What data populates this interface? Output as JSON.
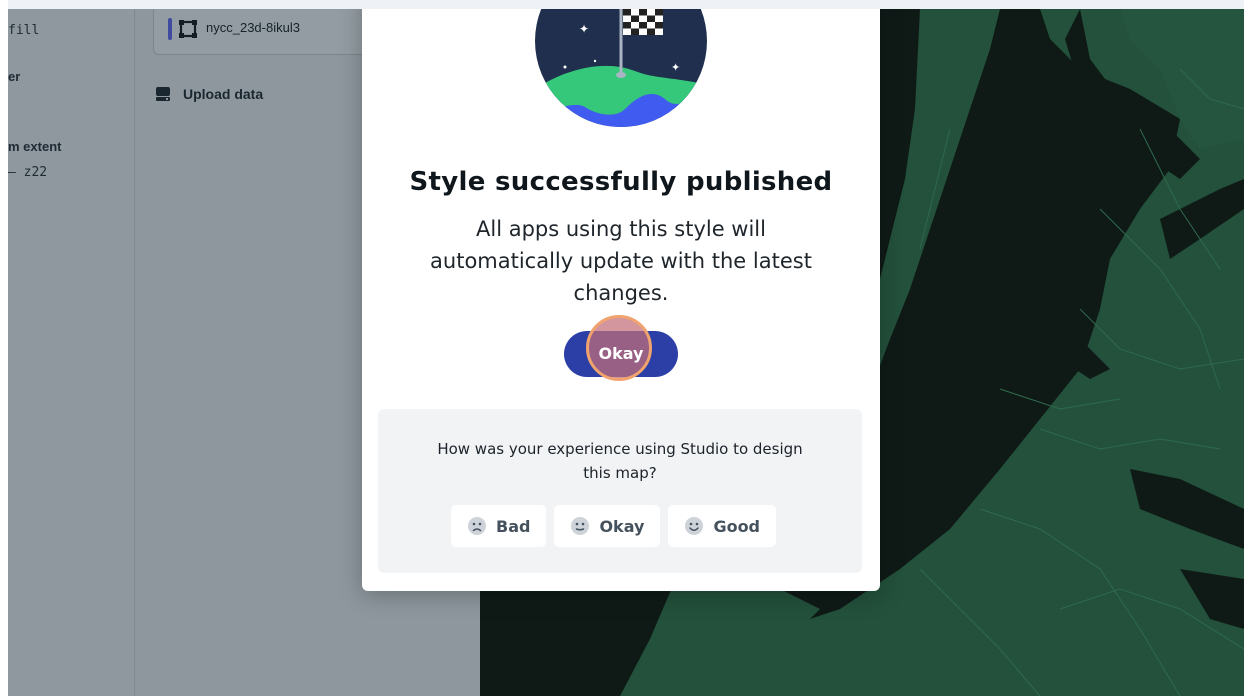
{
  "left_panel": {
    "fill_label": "fill",
    "layer_label": "er",
    "zoom_extent_label": "m extent",
    "zoom_value": "– z22"
  },
  "mid_panel": {
    "layer_name": "nycc_23d-8ikul3",
    "upload_label": "Upload data"
  },
  "modal": {
    "title": "Style successfully published",
    "description": "All apps using this style will automatically update with the latest changes.",
    "okay_button": "Okay",
    "feedback": {
      "question": "How was your experience using Studio to design this map?",
      "options": [
        {
          "label": "Bad",
          "icon": "sad-face-icon"
        },
        {
          "label": "Okay",
          "icon": "neutral-face-icon"
        },
        {
          "label": "Good",
          "icon": "happy-face-icon"
        }
      ]
    }
  },
  "colors": {
    "primary_button": "#2b3fa6",
    "map_land": "#23513b",
    "map_water": "#0f1a17",
    "overlay": "#8d979d"
  }
}
